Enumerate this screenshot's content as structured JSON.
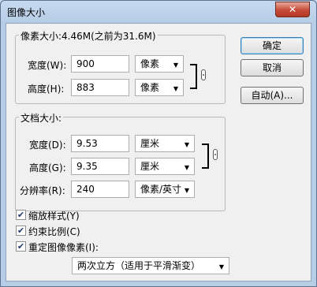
{
  "window": {
    "title": "图像大小",
    "close_glyph": "✕"
  },
  "pixel_dimensions": {
    "title": "像素大小:4.46M(之前为31.6M)",
    "width": {
      "label": "宽度(W):",
      "value": "900",
      "unit": "像素"
    },
    "height": {
      "label": "高度(H):",
      "value": "883",
      "unit": "像素"
    }
  },
  "document_size": {
    "title": "文档大小:",
    "width": {
      "label": "宽度(D):",
      "value": "9.53",
      "unit": "厘米"
    },
    "height": {
      "label": "高度(G):",
      "value": "9.35",
      "unit": "厘米"
    },
    "resolution": {
      "label": "分辨率(R):",
      "value": "240",
      "unit": "像素/英寸"
    }
  },
  "buttons": {
    "ok": "确定",
    "cancel": "取消",
    "auto": "自动(A)..."
  },
  "options": {
    "scale_styles": {
      "label": "缩放样式(Y)",
      "checked": true
    },
    "constrain": {
      "label": "约束比例(C)",
      "checked": true
    },
    "resample": {
      "label": "重定图像像素(I):",
      "checked": true
    },
    "resample_method": "两次立方（适用于平滑渐变）"
  },
  "icons": {
    "link": "chain-link-icon",
    "dropdown": "chevron-down-icon",
    "check": "checkmark-icon"
  },
  "check_glyph": "✔",
  "arrow_glyph": "▼"
}
